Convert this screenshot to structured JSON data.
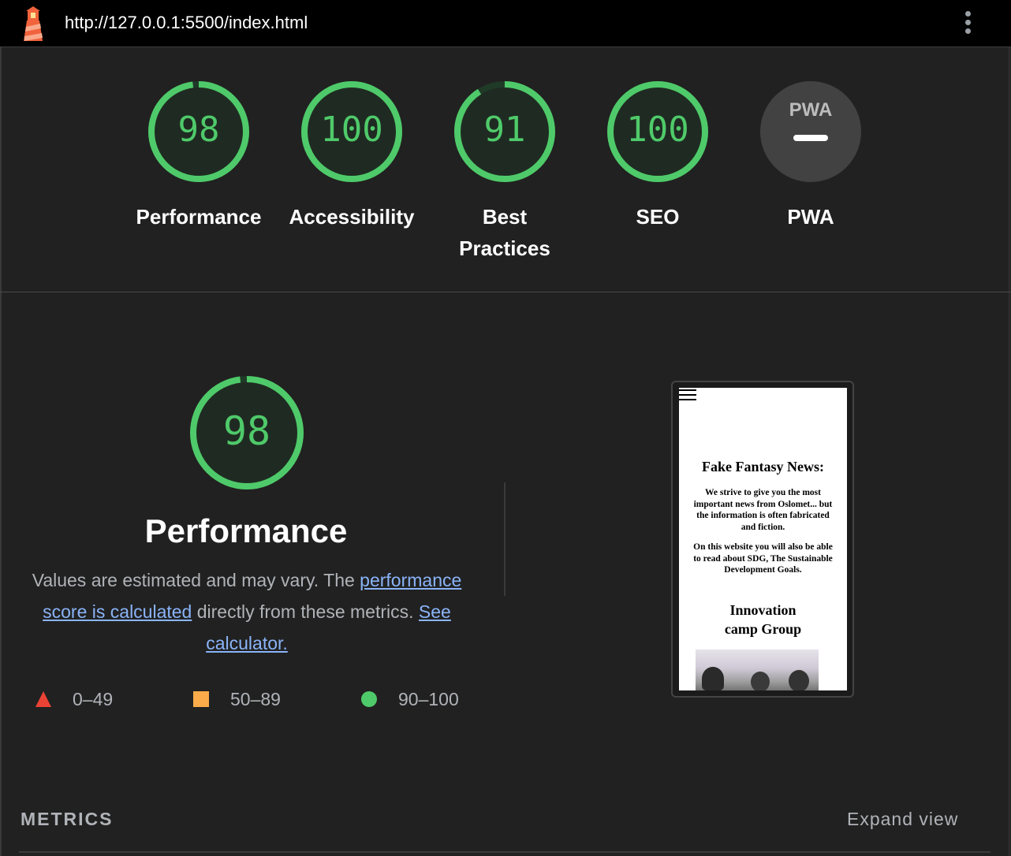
{
  "topbar": {
    "url": "http://127.0.0.1:5500/index.html"
  },
  "summary": {
    "gauges": [
      {
        "score": "98",
        "label": "Performance"
      },
      {
        "score": "100",
        "label": "Accessibility"
      },
      {
        "score": "91",
        "label": "Best Practices"
      },
      {
        "score": "100",
        "label": "SEO"
      },
      {
        "score": "",
        "label": "PWA",
        "badge_text": "PWA"
      }
    ]
  },
  "performance": {
    "score": "98",
    "title": "Performance",
    "desc_part1": "Values are estimated and may vary. The ",
    "desc_link1": "performance score is calculated",
    "desc_part2": " directly from these metrics. ",
    "desc_link2": "See calculator.",
    "legend": [
      {
        "range": "0–49",
        "color": "#ea4335"
      },
      {
        "range": "50–89",
        "color": "#fbab4a"
      },
      {
        "range": "90–100",
        "color": "#4fca6a"
      }
    ]
  },
  "thumbnail": {
    "heading": "Fake Fantasy News:",
    "para1": "We strive to give you the most important news from Oslomet... but the information is often fabricated and fiction.",
    "para2": "On this website you will also be able to read about SDG, The Sustainable Development Goals.",
    "subheading_line1": "Innovation",
    "subheading_line2": "camp Group"
  },
  "metrics": {
    "title": "METRICS",
    "expand_label": "Expand view"
  },
  "colors": {
    "pass": "#4fca6a",
    "average": "#fbab4a",
    "fail": "#ea4335",
    "link": "#8ab4f8"
  }
}
